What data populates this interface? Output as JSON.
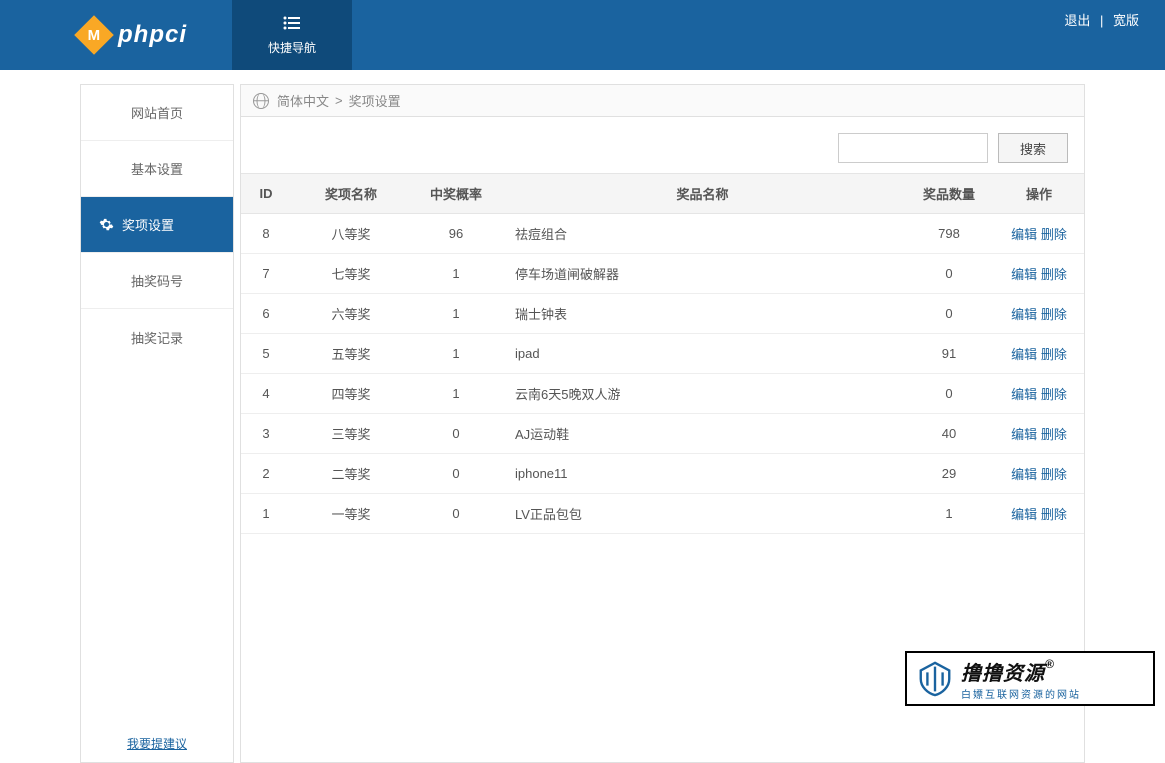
{
  "header": {
    "logo_letter": "M",
    "logo_text": "phpci",
    "quick_nav": "快捷导航",
    "logout": "退出",
    "wide": "宽版"
  },
  "sidebar": {
    "items": [
      {
        "label": "网站首页",
        "active": false
      },
      {
        "label": "基本设置",
        "active": false
      },
      {
        "label": "奖项设置",
        "active": true
      },
      {
        "label": "抽奖码号",
        "active": false
      },
      {
        "label": "抽奖记录",
        "active": false
      }
    ],
    "suggest": "我要提建议"
  },
  "breadcrumb": {
    "lang": "简体中文",
    "page": "奖项设置",
    "sep": ">"
  },
  "search": {
    "button": "搜索"
  },
  "table": {
    "headers": {
      "id": "ID",
      "name": "奖项名称",
      "prob": "中奖概率",
      "prize": "奖品名称",
      "qty": "奖品数量",
      "op": "操作"
    },
    "rows": [
      {
        "id": "8",
        "name": "八等奖",
        "prob": "96",
        "prize": "祛痘组合",
        "qty": "798"
      },
      {
        "id": "7",
        "name": "七等奖",
        "prob": "1",
        "prize": "停车场道闸破解器",
        "qty": "0"
      },
      {
        "id": "6",
        "name": "六等奖",
        "prob": "1",
        "prize": "瑞士钟表",
        "qty": "0"
      },
      {
        "id": "5",
        "name": "五等奖",
        "prob": "1",
        "prize": "ipad",
        "qty": "91"
      },
      {
        "id": "4",
        "name": "四等奖",
        "prob": "1",
        "prize": "云南6天5晚双人游",
        "qty": "0"
      },
      {
        "id": "3",
        "name": "三等奖",
        "prob": "0",
        "prize": "AJ运动鞋",
        "qty": "40"
      },
      {
        "id": "2",
        "name": "二等奖",
        "prob": "0",
        "prize": "iphone11",
        "qty": "29"
      },
      {
        "id": "1",
        "name": "一等奖",
        "prob": "0",
        "prize": "LV正品包包",
        "qty": "1"
      }
    ],
    "actions": {
      "edit": "编辑",
      "delete": "删除"
    }
  },
  "watermark": {
    "title": "撸撸资源",
    "reg": "®",
    "sub": "白嫖互联网资源的网站"
  }
}
